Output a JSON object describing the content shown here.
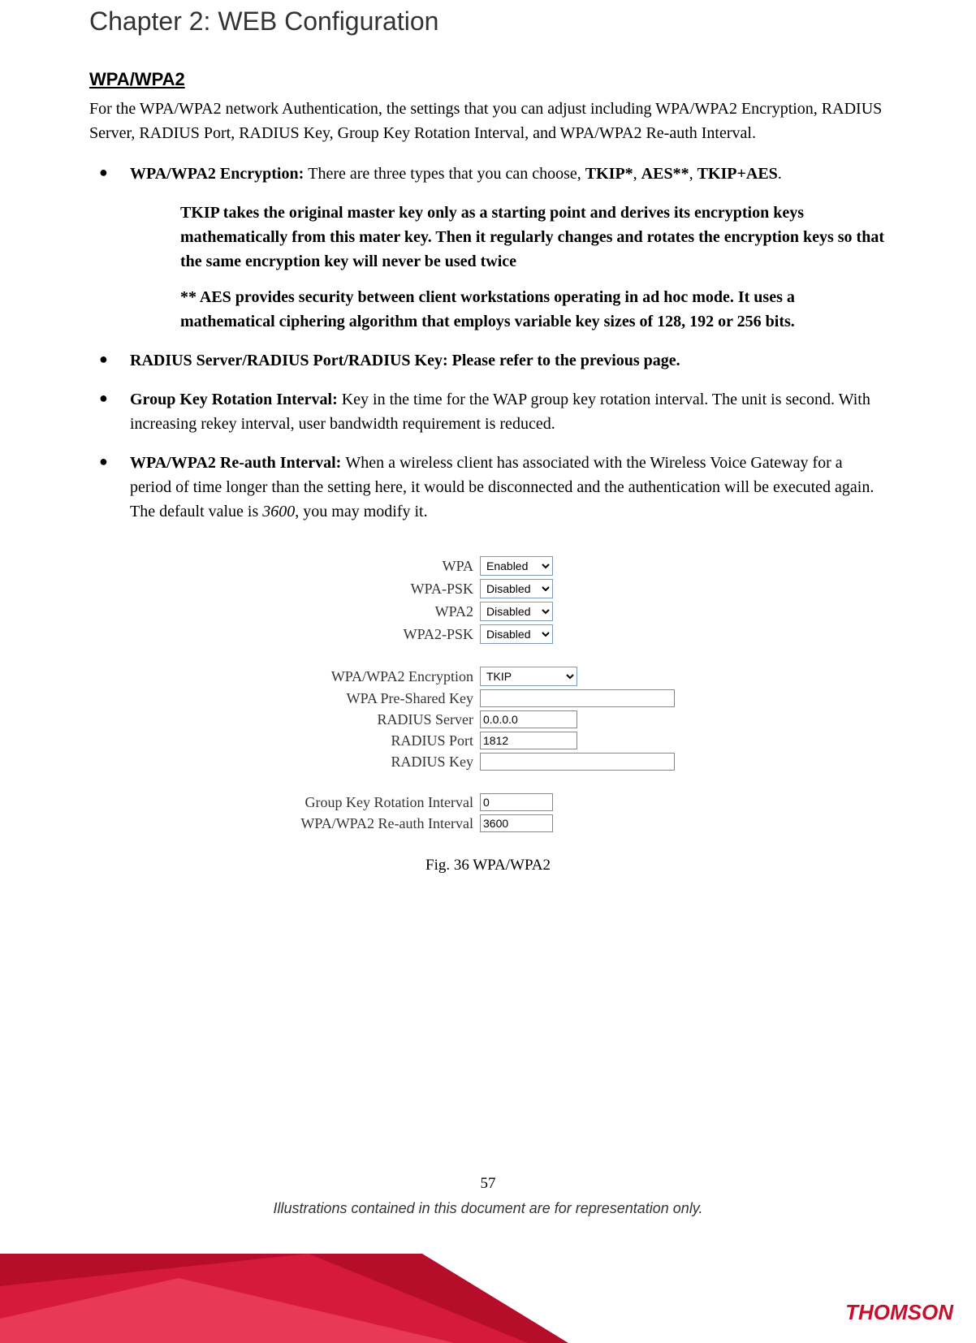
{
  "chapter_title": "Chapter 2: WEB Configuration",
  "section_heading": "WPA/WPA2",
  "intro": "For the WPA/WPA2 network Authentication, the settings that you can adjust including WPA/WPA2 Encryption, RADIUS Server, RADIUS Port, RADIUS Key, Group Key Rotation Interval, and WPA/WPA2 Re-auth Interval.",
  "bullets": {
    "b1_lead": "WPA/WPA2 Encryption: ",
    "b1_body_a": "There are three types that you can choose, ",
    "b1_tkip": "TKIP*",
    "b1_sep1": ", ",
    "b1_aes": "AES**",
    "b1_sep2": ", ",
    "b1_tkipaes": "TKIP+AES",
    "b1_end": ".",
    "note1": "TKIP takes the original master key only as a starting point and derives its encryption keys mathematically from this mater key. Then it regularly changes and rotates the encryption keys so that the same encryption key will never be used twice",
    "note2": "** AES provides security between client workstations operating in ad hoc mode. It uses a mathematical ciphering algorithm that employs variable key sizes of 128, 192 or 256 bits.",
    "b2": "RADIUS Server/RADIUS Port/RADIUS Key: Please refer to the previous page.",
    "b3_lead": "Group Key Rotation Interval: ",
    "b3_body": "Key in the time for the WAP group key rotation interval. The unit is second. With increasing rekey interval, user bandwidth requirement is reduced.",
    "b4_lead": "WPA/WPA2 Re-auth Interval: ",
    "b4_body_a": "When a wireless client has associated with the Wireless Voice Gateway for a period of time longer than the setting here, it would be disconnected and the authentication will be executed again. The default value is ",
    "b4_val": "3600",
    "b4_body_b": ", you may modify it."
  },
  "form": {
    "wpa_label": "WPA",
    "wpa_value": "Enabled",
    "wpapsk_label": "WPA-PSK",
    "wpapsk_value": "Disabled",
    "wpa2_label": "WPA2",
    "wpa2_value": "Disabled",
    "wpa2psk_label": "WPA2-PSK",
    "wpa2psk_value": "Disabled",
    "enc_label": "WPA/WPA2 Encryption",
    "enc_value": "TKIP",
    "psk_label": "WPA Pre-Shared Key",
    "psk_value": "",
    "radius_server_label": "RADIUS Server",
    "radius_server_value": "0.0.0.0",
    "radius_port_label": "RADIUS Port",
    "radius_port_value": "1812",
    "radius_key_label": "RADIUS Key",
    "radius_key_value": "",
    "gkri_label": "Group Key Rotation Interval",
    "gkri_value": "0",
    "reauth_label": "WPA/WPA2 Re-auth Interval",
    "reauth_value": "3600"
  },
  "fig_caption": "Fig. 36 WPA/WPA2",
  "page_number": "57",
  "footer_note": "Illustrations contained in this document are for representation only.",
  "brand": "THOMSON"
}
